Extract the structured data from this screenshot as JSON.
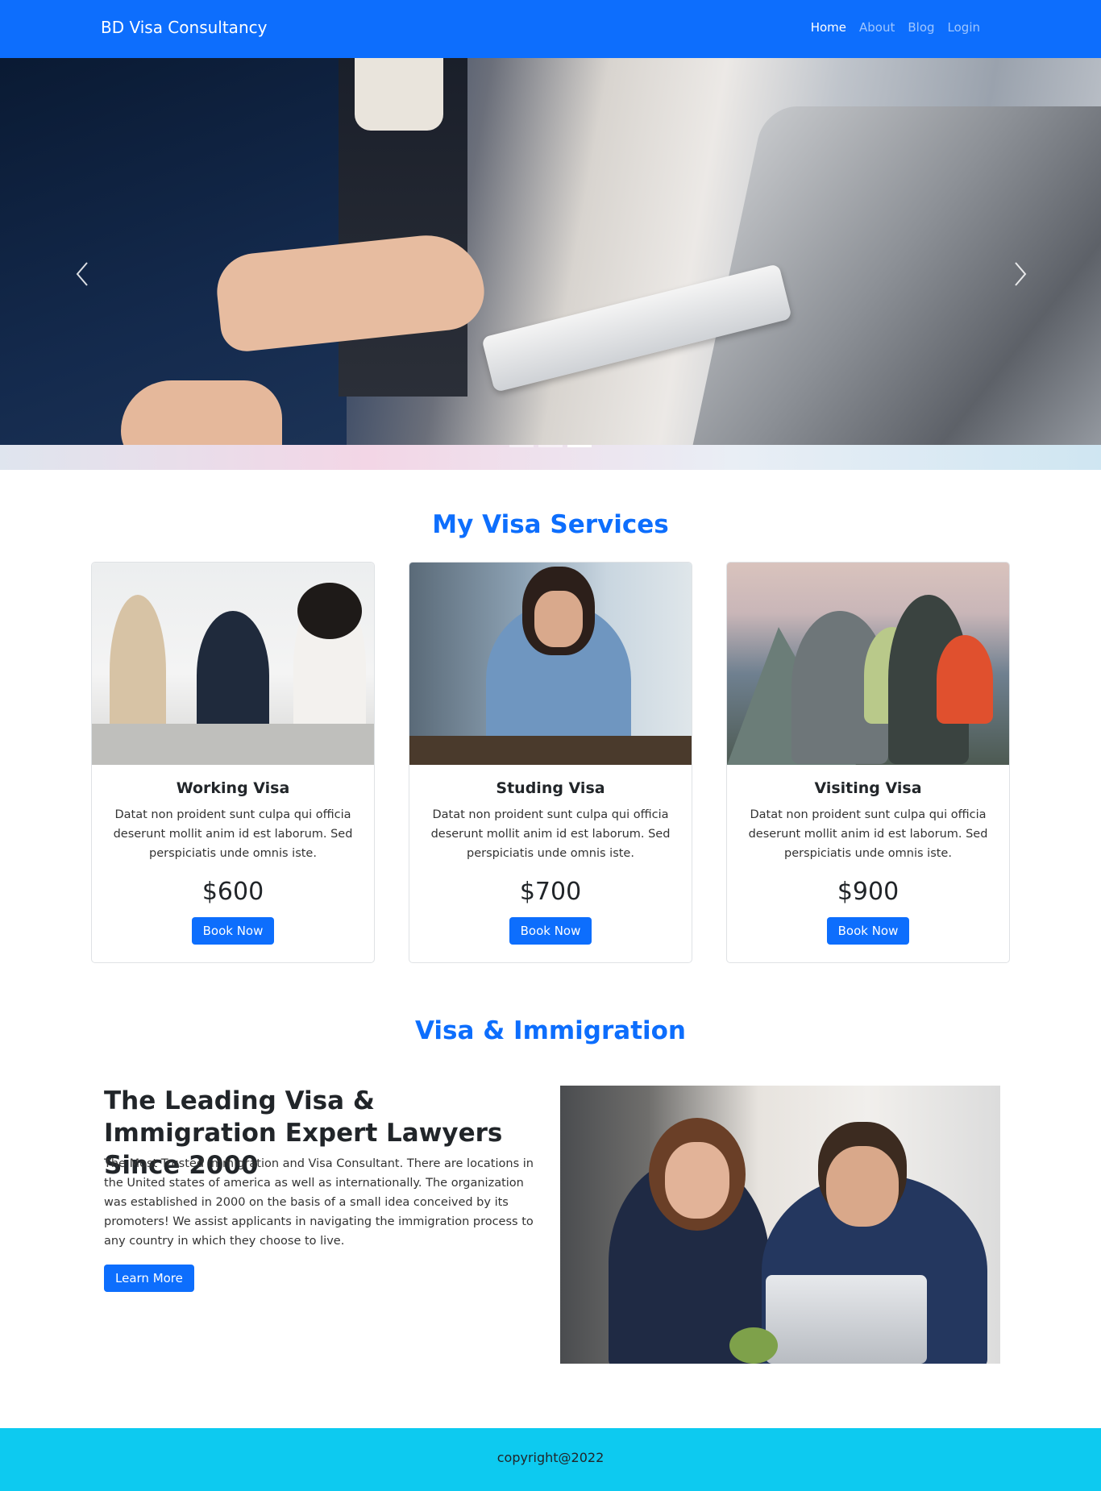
{
  "navbar": {
    "brand": "BD Visa Consultancy",
    "links": [
      {
        "label": "Home",
        "active": true
      },
      {
        "label": "About",
        "active": false
      },
      {
        "label": "Blog",
        "active": false
      },
      {
        "label": "Login",
        "active": false
      }
    ]
  },
  "carousel": {
    "prev_icon": "chevron-left-icon",
    "next_icon": "chevron-right-icon",
    "slide_count": 3,
    "active_slide": 3
  },
  "services": {
    "title": "My Visa Services",
    "cards": [
      {
        "title": "Working Visa",
        "text": "Datat non proident sunt culpa qui officia deserunt mollit anim id est laborum. Sed perspiciatis unde omnis iste.",
        "price": "$600",
        "button": "Book Now"
      },
      {
        "title": "Studing Visa",
        "text": "Datat non proident sunt culpa qui officia deserunt mollit anim id est laborum. Sed perspiciatis unde omnis iste.",
        "price": "$700",
        "button": "Book Now"
      },
      {
        "title": "Visiting Visa",
        "text": "Datat non proident sunt culpa qui officia deserunt mollit anim id est laborum. Sed perspiciatis unde omnis iste.",
        "price": "$900",
        "button": "Book Now"
      }
    ]
  },
  "immigration": {
    "title": "Visa & Immigration",
    "heading": "The Leading Visa & Immigration Expert Lawyers Since 2000",
    "text": "The Most Trusted Immigration and Visa Consultant. There are locations in the United states of america as well as internationally. The organization was established in 2000 on the basis of a small idea conceived by its promoters! We assist applicants in navigating the immigration process to any country in which they choose to live.",
    "button": "Learn More"
  },
  "footer": {
    "text": "copyright@2022"
  },
  "colors": {
    "primary": "#0d6efd",
    "footer": "#0dcaf0"
  }
}
